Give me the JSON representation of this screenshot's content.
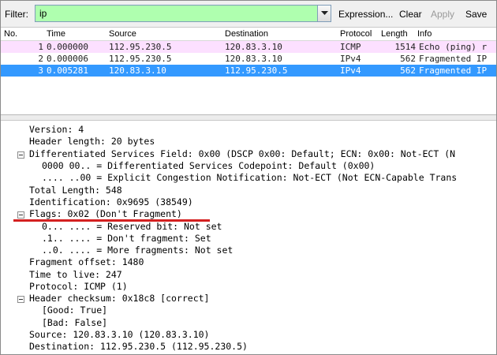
{
  "toolbar": {
    "filter_label": "Filter:",
    "filter_value": "ip",
    "expression_label": "Expression...",
    "clear_label": "Clear",
    "apply_label": "Apply",
    "save_label": "Save"
  },
  "packet_list": {
    "columns": [
      "No.",
      "Time",
      "Source",
      "Destination",
      "Protocol",
      "Length",
      "Info"
    ],
    "rows": [
      {
        "no": "1",
        "time": "0.000000",
        "source": "112.95.230.5",
        "destination": "120.83.3.10",
        "protocol": "ICMP",
        "length": "1514",
        "info": "Echo (ping) r"
      },
      {
        "no": "2",
        "time": "0.000006",
        "source": "112.95.230.5",
        "destination": "120.83.3.10",
        "protocol": "IPv4",
        "length": "562",
        "info": "Fragmented IP"
      },
      {
        "no": "3",
        "time": "0.005281",
        "source": "120.83.3.10",
        "destination": "112.95.230.5",
        "protocol": "IPv4",
        "length": "562",
        "info": "Fragmented IP"
      }
    ]
  },
  "details": {
    "lines": [
      "Version: 4",
      "Header length: 20 bytes",
      "Differentiated Services Field: 0x00 (DSCP 0x00: Default; ECN: 0x00: Not-ECT (N",
      "0000 00.. = Differentiated Services Codepoint: Default (0x00)",
      ".... ..00 = Explicit Congestion Notification: Not-ECT (Not ECN-Capable Trans",
      "Total Length: 548",
      "Identification: 0x9695 (38549)",
      "Flags: 0x02 (Don't Fragment)",
      "0... .... = Reserved bit: Not set",
      ".1.. .... = Don't fragment: Set",
      "..0. .... = More fragments: Not set",
      "Fragment offset: 1480",
      "Time to live: 247",
      "Protocol: ICMP (1)",
      "Header checksum: 0x18c8 [correct]",
      "[Good: True]",
      "[Bad: False]",
      "Source: 120.83.3.10 (120.83.3.10)",
      "Destination: 112.95.230.5 (112.95.230.5)"
    ]
  },
  "colors": {
    "filter_bg": "#afffaf",
    "icmp_row": "#fce0ff",
    "selected_row": "#3399ff",
    "annotation_underline": "#d42020"
  }
}
